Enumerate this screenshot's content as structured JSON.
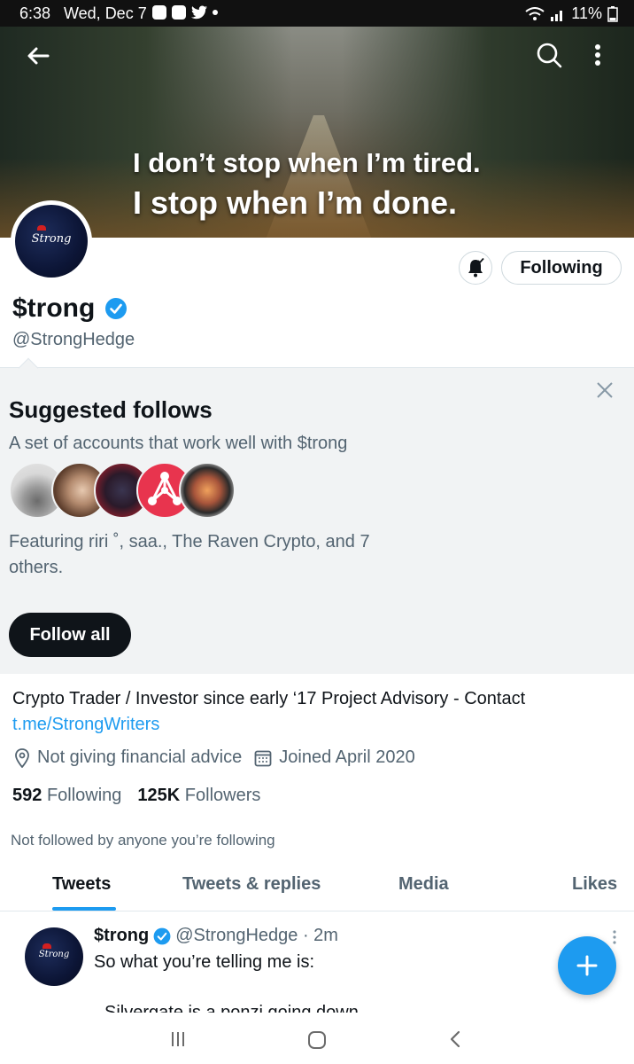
{
  "status_bar": {
    "time": "6:38",
    "date": "Wed, Dec 7",
    "battery": "11%"
  },
  "banner": {
    "quote_line1": "I don’t stop when I’m tired.",
    "quote_line2": "I stop when I’m done."
  },
  "profile": {
    "name": "$trong",
    "handle": "@StrongHedge",
    "avatar_text": "Strong",
    "following_button": "Following",
    "bio_text": "Crypto Trader / Investor since early ‘17 Project   Advisory - Contact",
    "bio_link": "t.me/StrongWriters",
    "location": "Not giving financial advice",
    "joined": "Joined April 2020",
    "following_count": "592",
    "following_label": "Following",
    "followers_count": "125K",
    "followers_label": "Followers",
    "not_followed": "Not followed by anyone you’re following"
  },
  "suggested": {
    "title": "Suggested follows",
    "subtitle": "A set of accounts that work well with $trong",
    "featuring": "Featuring riri ˚, saa., The Raven Crypto, and 7 others.",
    "follow_all": "Follow all"
  },
  "tabs": [
    {
      "label": "Tweets"
    },
    {
      "label": "Tweets & replies"
    },
    {
      "label": "Media"
    },
    {
      "label": "Likes"
    }
  ],
  "tweet": {
    "name": "$trong",
    "handle_time": "@StrongHedge · 2m",
    "text": "So what you’re telling me is:",
    "text2": "Silvergate is a ponzi going down"
  },
  "colors": {
    "accent": "#1d9bf0",
    "text": "#0f1419",
    "muted": "#536471",
    "suggest_bg": "#f1f3f4"
  }
}
